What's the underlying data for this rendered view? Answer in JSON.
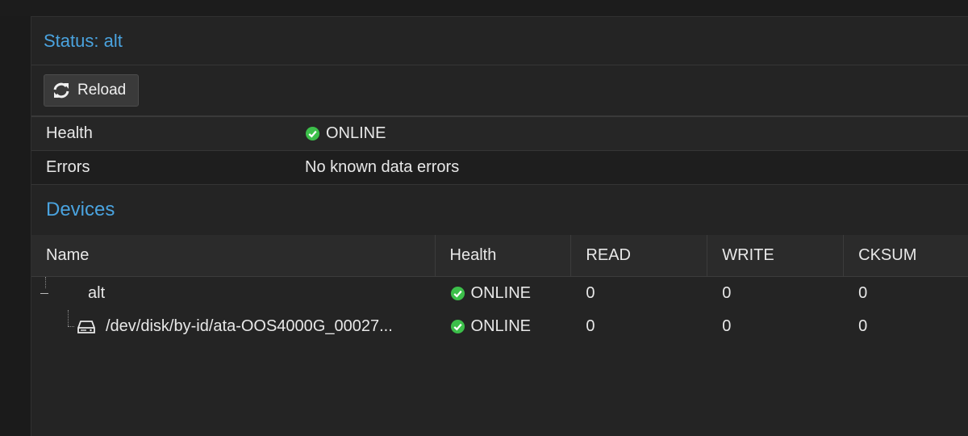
{
  "window": {
    "title": "Status: alt"
  },
  "toolbar": {
    "reload_label": "Reload",
    "reload_icon": "refresh-icon"
  },
  "status": {
    "health_label": "Health",
    "health_value": "ONLINE",
    "errors_label": "Errors",
    "errors_value": "No known data errors"
  },
  "colors": {
    "accent": "#4aa3df",
    "online": "#3cbf4a"
  },
  "devices": {
    "heading": "Devices",
    "columns": {
      "name": "Name",
      "health": "Health",
      "read": "READ",
      "write": "WRITE",
      "cksum": "CKSUM"
    },
    "rows": [
      {
        "name": "alt",
        "health": "ONLINE",
        "read": "0",
        "write": "0",
        "cksum": "0",
        "icon": "pool-icon"
      },
      {
        "name": "/dev/disk/by-id/ata-OOS4000G_00027...",
        "health": "ONLINE",
        "read": "0",
        "write": "0",
        "cksum": "0",
        "icon": "hard-drive-icon"
      }
    ]
  }
}
